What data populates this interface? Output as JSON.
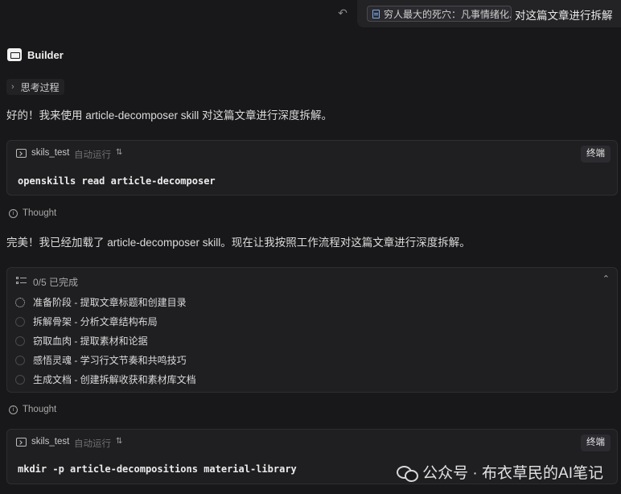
{
  "user_message": {
    "attachment": "穷人最大的死穴：凡事情绪化...",
    "text": "对这篇文章进行拆解"
  },
  "icons": {
    "undo": "undo-icon",
    "file": "file-icon",
    "builder": "builder-icon",
    "terminal": "terminal-icon",
    "thought": "info-icon",
    "todo": "checklist-icon"
  },
  "assistant": {
    "name": "Builder",
    "thinking_label": "思考过程",
    "intro": "好的！我来使用 article-decomposer skill 对这篇文章进行深度拆解。",
    "followup": "完美！我已经加载了 article-decomposer skill。现在让我按照工作流程对这篇文章进行深度拆解。"
  },
  "commands": [
    {
      "name": "skils_test",
      "mode": "自动运行",
      "button": "终端",
      "code": "openskills read article-decomposer"
    },
    {
      "name": "skils_test",
      "mode": "自动运行",
      "button": "终端",
      "code": "mkdir -p article-decompositions material-library"
    }
  ],
  "thought_label": "Thought",
  "todo": {
    "status": "0/5 已完成",
    "items": [
      {
        "label": "准备阶段 - 提取文章标题和创建目录",
        "state": "in_progress"
      },
      {
        "label": "拆解骨架 - 分析文章结构布局",
        "state": "pending"
      },
      {
        "label": "窃取血肉 - 提取素材和论据",
        "state": "pending"
      },
      {
        "label": "感悟灵魂 - 学习行文节奏和共鸣技巧",
        "state": "pending"
      },
      {
        "label": "生成文档 - 创建拆解收获和素材库文档",
        "state": "pending"
      }
    ]
  },
  "watermark": "公众号 · 布衣草民的AI笔记"
}
